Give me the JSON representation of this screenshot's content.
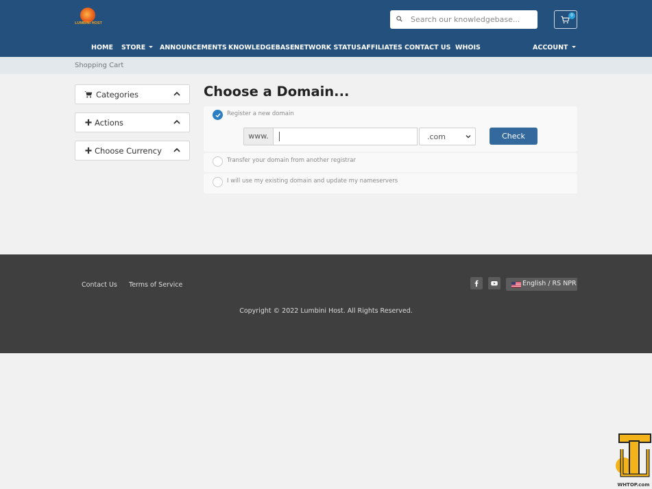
{
  "brand": {
    "name": "LUMBINI HOST"
  },
  "search": {
    "placeholder": "Search our knowledgebase..."
  },
  "cart": {
    "count": "0"
  },
  "nav": [
    {
      "label": "HOME"
    },
    {
      "label": "STORE"
    },
    {
      "label": "ANNOUNCEMENTS"
    },
    {
      "label": "KNOWLEDGEBASE"
    },
    {
      "label": "NETWORK STATUS"
    },
    {
      "label": "AFFILIATES"
    },
    {
      "label": "CONTACT US"
    },
    {
      "label": "WHOIS"
    },
    {
      "label": "ACCOUNT"
    }
  ],
  "breadcrumb": {
    "current": "Shopping Cart"
  },
  "sidebar": [
    {
      "label": "Categories",
      "icon": "shopping-cart-icon"
    },
    {
      "label": "Actions",
      "icon": "plus-icon"
    },
    {
      "label": "Choose Currency",
      "icon": "plus-icon"
    }
  ],
  "main": {
    "title": "Choose a Domain...",
    "options": [
      {
        "label": "Register a new domain",
        "checked": true
      },
      {
        "label": "Transfer your domain from another registrar",
        "checked": false
      },
      {
        "label": "I will use my existing domain and update my nameservers",
        "checked": false
      }
    ],
    "register": {
      "prefix": "www.",
      "domain_value": "",
      "tld_selected": ".com",
      "check_label": "Check"
    }
  },
  "footer": {
    "links": [
      {
        "label": "Contact Us"
      },
      {
        "label": "Terms of Service"
      }
    ],
    "language": "English / RS NPR",
    "copyright": "Copyright © 2022 Lumbini Host. All Rights Reserved."
  },
  "watermark": {
    "text": "WHTOP.com"
  },
  "colors": {
    "header": "#23507d",
    "accent": "#2b7fc3",
    "button": "#34699e",
    "footer": "#3f3f3f"
  }
}
